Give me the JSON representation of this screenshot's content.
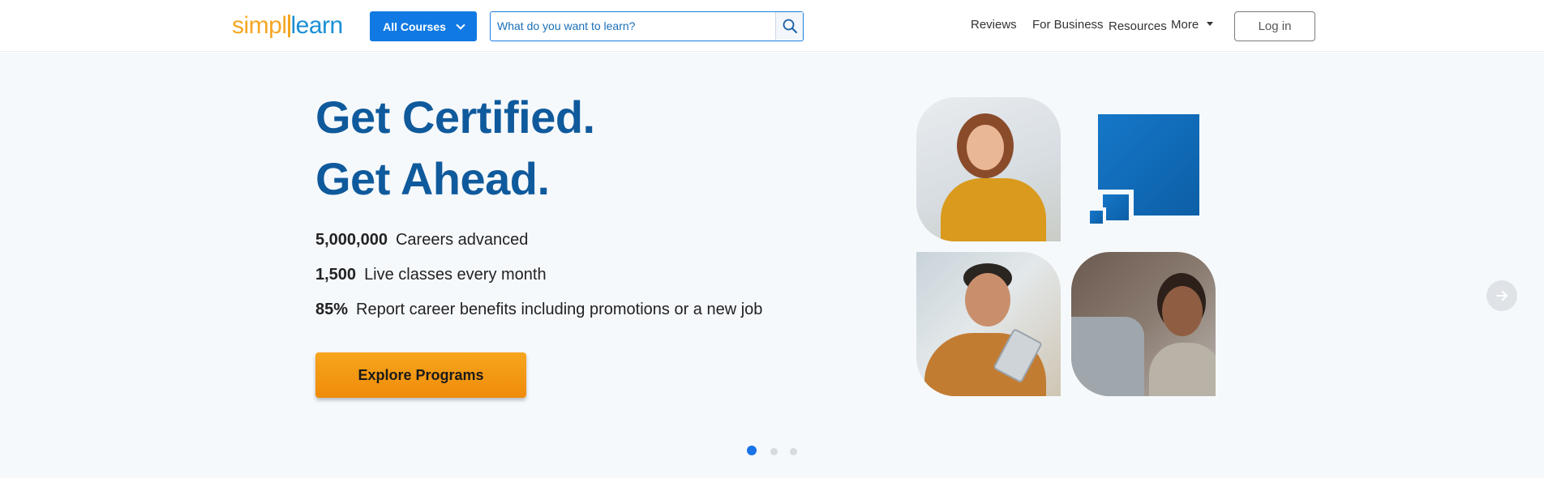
{
  "header": {
    "logo": {
      "part1": "simpl",
      "part2": "learn"
    },
    "all_courses_label": "All Courses",
    "search": {
      "placeholder": "What do you want to learn?",
      "value": ""
    },
    "nav": {
      "reviews": "Reviews",
      "for_business": "For Business",
      "resources": "Resources",
      "more": "More"
    },
    "login_label": "Log in"
  },
  "hero": {
    "headline_line1": "Get Certified.",
    "headline_line2": "Get Ahead.",
    "stats": [
      {
        "value": "5,000,000",
        "label": "Careers advanced"
      },
      {
        "value": "1,500",
        "label": "Live classes every month"
      },
      {
        "value": "85%",
        "label": "Report career benefits including promotions or a new job"
      }
    ],
    "cta_label": "Explore Programs"
  },
  "carousel": {
    "slide_count": 3,
    "active_index": 0
  },
  "icons": {
    "search": "search-icon",
    "dropdown": "chevron-down-icon",
    "more": "caret-down-icon",
    "next": "arrow-right-icon"
  },
  "colors": {
    "primary_blue": "#1179e3",
    "headline_blue": "#0f5a9c",
    "cta_orange": "#f39a14",
    "logo_orange": "#f5a623",
    "logo_blue": "#1a8fd6",
    "hero_bg": "#f6f9fc"
  }
}
